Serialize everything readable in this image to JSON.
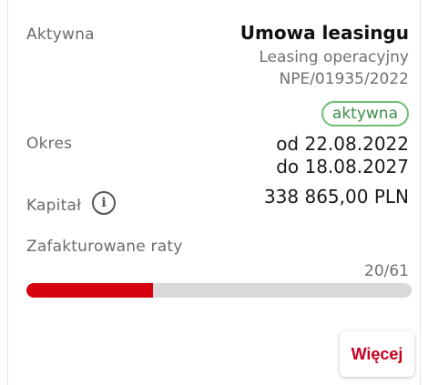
{
  "status_label": "Aktywna",
  "contract": {
    "title": "Umowa leasingu",
    "type": "Leasing operacyjny",
    "number": "NPE/01935/2022",
    "status_badge": "aktywna"
  },
  "period": {
    "label": "Okres",
    "from": "od 22.08.2022",
    "to": "do 18.08.2027"
  },
  "capital": {
    "label": "Kapitał",
    "icon": "info-icon",
    "value": "338 865,00 PLN"
  },
  "installments": {
    "label": "Zafakturowane raty",
    "counter": "20/61",
    "progress_fraction": 0.3279
  },
  "button": {
    "more_label": "Więcej"
  },
  "colors": {
    "accent_red": "#d7000f",
    "badge_green": "#6fbf73",
    "track_gray": "#d9d9d9"
  }
}
